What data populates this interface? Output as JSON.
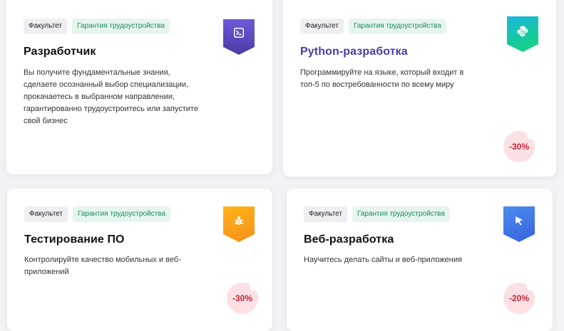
{
  "cards": [
    {
      "tags": {
        "faculty": "Факультет",
        "guarantee": "Гарантия трудоустройства"
      },
      "title": "Разработчик",
      "description": "Вы получите фундаментальные знания, сделаете осознанный выбор специализации, прокачаетесь в выбранном направлении, гарантированно трудоустроитесь или запустите свой бизнес",
      "icon": "terminal-icon",
      "accent_color": "#5a48c4"
    },
    {
      "tags": {
        "faculty": "Факультет",
        "guarantee": "Гарантия трудоустройства"
      },
      "title": "Python-разработка",
      "description": "Программируйте на языке, который входит в топ-5 по востребованности по всему миру",
      "icon": "python-icon",
      "discount": "-30%",
      "accent_color": "#18c4a0"
    },
    {
      "tags": {
        "faculty": "Факультет",
        "guarantee": "Гарантия трудоустройства"
      },
      "title": "Тестирование ПО",
      "description": "Контролируйте качество мобильных и веб-приложений",
      "icon": "bug-icon",
      "discount": "-30%",
      "accent_color": "#f7a11a"
    },
    {
      "tags": {
        "faculty": "Факультет",
        "guarantee": "Гарантия трудоустройства"
      },
      "title": "Веб-разработка",
      "description": "Научитесь делать сайты и веб-приложения",
      "icon": "cursor-icon",
      "discount": "-20%",
      "accent_color": "#4378e8"
    }
  ]
}
